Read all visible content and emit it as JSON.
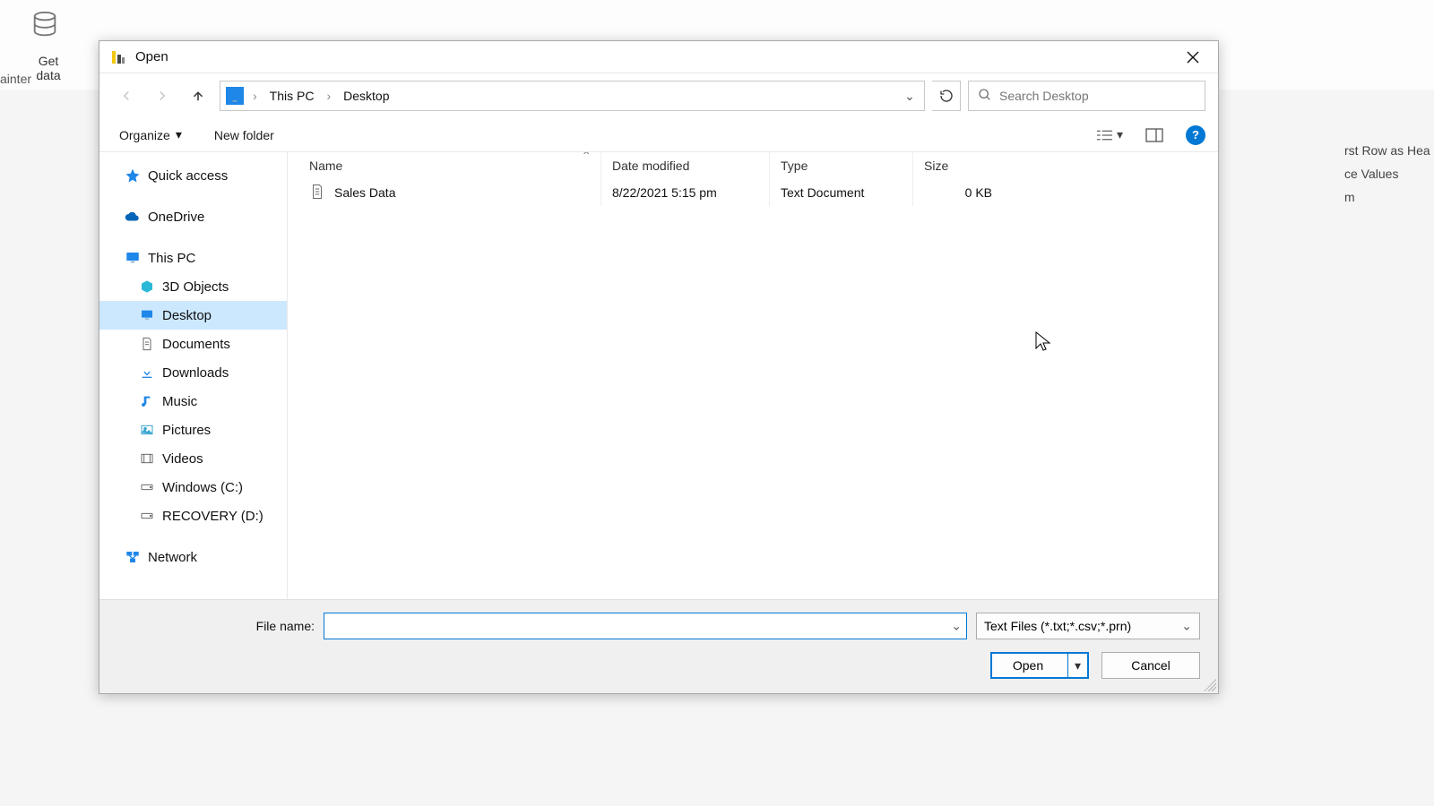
{
  "background": {
    "get_data_label": "Get\ndata",
    "painter_label": "ainter",
    "right_items": [
      "rst Row as Hea",
      "ce Values",
      "m"
    ]
  },
  "dialog": {
    "title": "Open",
    "breadcrumbs": [
      "This PC",
      "Desktop"
    ],
    "search_placeholder": "Search Desktop",
    "toolbar": {
      "organize": "Organize",
      "new_folder": "New folder"
    },
    "nav_tree": {
      "quick_access": "Quick access",
      "onedrive": "OneDrive",
      "this_pc": "This PC",
      "children": [
        {
          "label": "3D Objects",
          "icon": "cube"
        },
        {
          "label": "Desktop",
          "icon": "monitor",
          "selected": true
        },
        {
          "label": "Documents",
          "icon": "doc"
        },
        {
          "label": "Downloads",
          "icon": "download"
        },
        {
          "label": "Music",
          "icon": "music"
        },
        {
          "label": "Pictures",
          "icon": "pictures"
        },
        {
          "label": "Videos",
          "icon": "videos"
        },
        {
          "label": "Windows (C:)",
          "icon": "drive"
        },
        {
          "label": "RECOVERY (D:)",
          "icon": "drive"
        }
      ],
      "network": "Network"
    },
    "columns": {
      "name": "Name",
      "date": "Date modified",
      "type": "Type",
      "size": "Size"
    },
    "files": [
      {
        "name": "Sales Data",
        "date": "8/22/2021 5:15 pm",
        "type": "Text Document",
        "size": "0 KB"
      }
    ],
    "filename_label": "File name:",
    "filename_value": "",
    "filetype_value": "Text Files (*.txt;*.csv;*.prn)",
    "open_label": "Open",
    "cancel_label": "Cancel"
  }
}
